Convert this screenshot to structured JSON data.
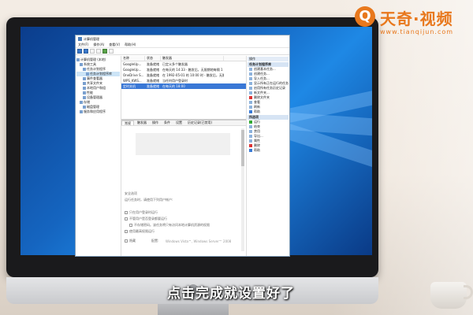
{
  "window": {
    "title": "计算机管理",
    "menu": [
      "文件(F)",
      "操作(A)",
      "查看(V)",
      "帮助(H)"
    ]
  },
  "tree": [
    {
      "label": "计算机管理 (本地)",
      "indent": 0
    },
    {
      "label": "系统工具",
      "indent": 1
    },
    {
      "label": "任务计划程序",
      "indent": 2
    },
    {
      "label": "任务计划程序库",
      "indent": 3,
      "selected": true
    },
    {
      "label": "事件查看器",
      "indent": 2
    },
    {
      "label": "共享文件夹",
      "indent": 2
    },
    {
      "label": "本地用户和组",
      "indent": 2
    },
    {
      "label": "性能",
      "indent": 2
    },
    {
      "label": "设备管理器",
      "indent": 2
    },
    {
      "label": "存储",
      "indent": 1
    },
    {
      "label": "磁盘管理",
      "indent": 2
    },
    {
      "label": "服务和应用程序",
      "indent": 1
    }
  ],
  "task_list": {
    "headers": [
      "名称",
      "状态",
      "触发器"
    ],
    "rows": [
      {
        "name": "GoogleUp...",
        "status": "准备就绪",
        "trigger": "已定义多个触发器",
        "selected": false
      },
      {
        "name": "GoogleUp...",
        "status": "准备就绪",
        "trigger": "在每天的 14:33 - 触发后，无限期地每隔 1 小时 重复一次。",
        "selected": false
      },
      {
        "name": "OneDrive S...",
        "status": "准备就绪",
        "trigger": "在 1992-05-01 的 10:00 时 - 触发后，无限期地每隔 1.00:00:00 重复一次。",
        "selected": false
      },
      {
        "name": "WPS_KWS...",
        "status": "准备就绪",
        "trigger": "当任何用户登录时",
        "selected": false
      },
      {
        "name": "定时关机",
        "status": "准备就绪",
        "trigger": "在每天的 18:00",
        "selected": true
      }
    ]
  },
  "detail": {
    "tabs": [
      "常规",
      "触发器",
      "操作",
      "条件",
      "设置",
      "历史记录(已禁用)"
    ],
    "labels": {
      "security_options": "安全选项",
      "run_as": "运行任务时，请使用下列用户帐户:",
      "radio_only_logged_on": "只在用户登录时运行",
      "radio_whether_logged_on": "不管用户是否登录都要运行",
      "checkbox_no_password": "不存储密码。该任务将只有访问本地计算机资源的权限",
      "checkbox_highest": "使用最高权限运行",
      "hidden": "隐藏",
      "configure_for": "配置:",
      "configure_value": "Windows Vista™, Windows Server™ 2008"
    }
  },
  "actions": {
    "header": "操作",
    "sub1": "任务计划程序库",
    "items1": [
      {
        "label": "创建基本任务...",
        "icon": "task-icon"
      },
      {
        "label": "创建任务...",
        "icon": "task-icon"
      },
      {
        "label": "导入任务...",
        "icon": "import-icon"
      },
      {
        "label": "显示所有正在运行的任务",
        "icon": "list-icon"
      },
      {
        "label": "启用所有任务历史记录",
        "icon": "history-icon"
      },
      {
        "label": "新文件夹...",
        "icon": "folder-icon"
      },
      {
        "label": "删除文件夹",
        "icon": "delete-icon"
      },
      {
        "label": "查看",
        "icon": "view-icon"
      },
      {
        "label": "刷新",
        "icon": "refresh-icon"
      },
      {
        "label": "帮助",
        "icon": "help-icon"
      }
    ],
    "sub2": "所选项",
    "items2": [
      {
        "label": "运行",
        "icon": "run-icon"
      },
      {
        "label": "结束",
        "icon": "end-icon"
      },
      {
        "label": "禁用",
        "icon": "disable-icon"
      },
      {
        "label": "导出...",
        "icon": "export-icon"
      },
      {
        "label": "属性",
        "icon": "properties-icon"
      },
      {
        "label": "删除",
        "icon": "delete-icon"
      },
      {
        "label": "帮助",
        "icon": "help-icon"
      }
    ]
  },
  "watermark": {
    "brand": "天奇·视频",
    "url": "www.tianqijun.com"
  },
  "caption": "点击完成就设置好了"
}
